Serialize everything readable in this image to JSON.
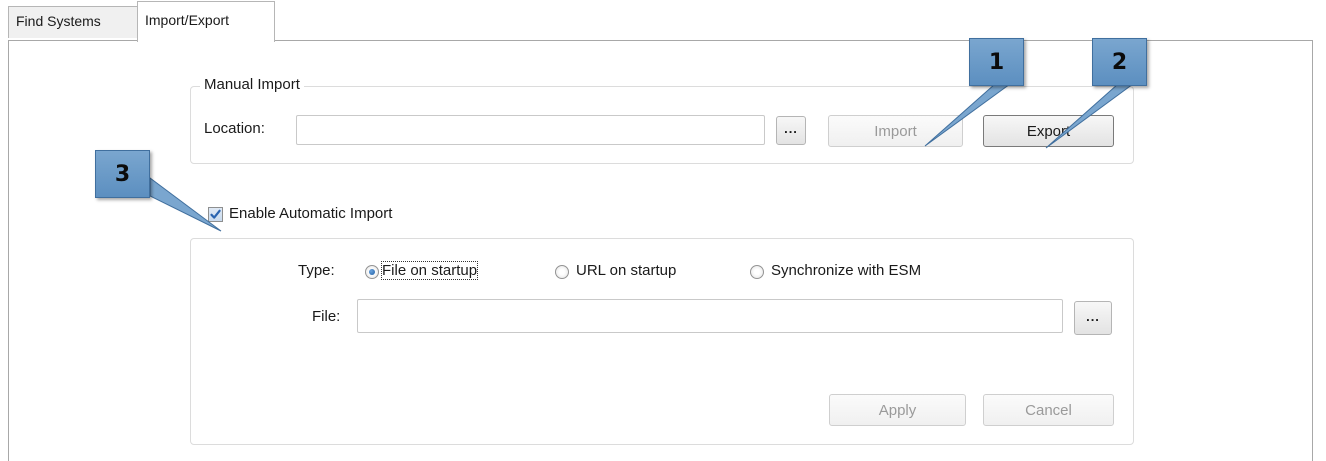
{
  "tabs": [
    {
      "label": "Find Systems",
      "active": false
    },
    {
      "label": "Import/Export",
      "active": true
    }
  ],
  "manual_import": {
    "legend": "Manual Import",
    "location_label": "Location:",
    "location_value": "",
    "browse_label": "...",
    "import_label": "Import",
    "export_label": "Export",
    "import_enabled": false
  },
  "auto_import": {
    "enable_label": "Enable Automatic Import",
    "enabled": true,
    "type_label": "Type:",
    "options": [
      {
        "label": "File on startup",
        "selected": true
      },
      {
        "label": "URL on startup",
        "selected": false
      },
      {
        "label": "Synchronize with  ESM",
        "selected": false
      }
    ],
    "file_label": "File:",
    "file_value": "",
    "browse_label": "...",
    "apply_label": "Apply",
    "cancel_label": "Cancel"
  },
  "callouts": [
    "1",
    "2",
    "3"
  ],
  "colors": {
    "callout_fill": "#6b9ac9",
    "callout_border": "#406f9e",
    "checkbox_check": "#2a64b0"
  }
}
